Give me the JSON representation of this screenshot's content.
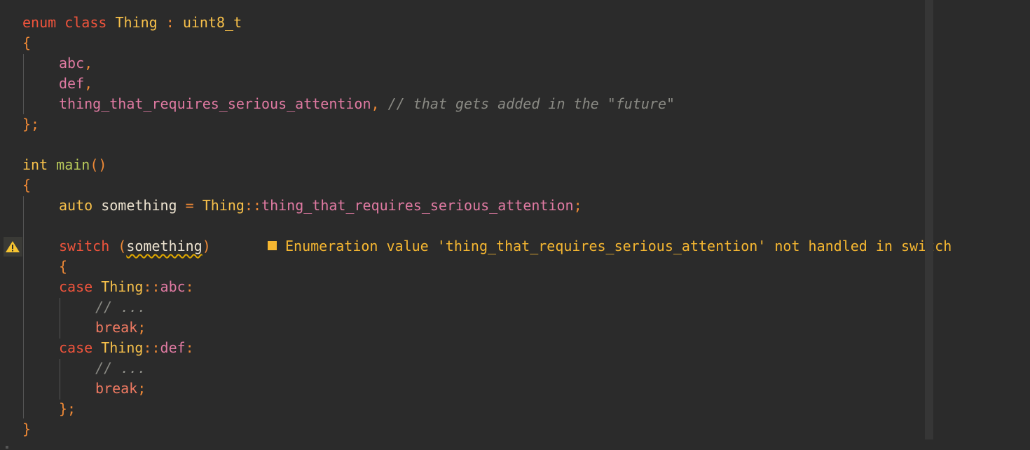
{
  "code": {
    "enum_kw": "enum",
    "class_kw": "class",
    "enum_name": "Thing",
    "colon": ":",
    "underlying_type": "uint8_t",
    "open_brace": "{",
    "close_brace": "}",
    "close_brace_semi": "};",
    "semicolon": ";",
    "comma": ",",
    "enumerators": [
      "abc",
      "def",
      "thing_that_requires_serious_attention"
    ],
    "enum_comment": "// that gets added in the \"future\"",
    "int_kw": "int",
    "main_name": "main",
    "main_parens": "()",
    "auto_kw": "auto",
    "var_name": "something",
    "assign_op": "=",
    "scope_op": "::",
    "switch_kw": "switch",
    "paren_open": "(",
    "paren_close": ")",
    "case_kw": "case",
    "case_colon": ":",
    "case_comment": "// ...",
    "break_kw": "break"
  },
  "diagnostic": {
    "message": "Enumeration value 'thing_that_requires_serious_attention' not handled in switch",
    "severity": "warning",
    "color": "#f6b731"
  },
  "colors": {
    "background": "#2b2b2b",
    "keyword": "#f0543c",
    "type": "#f7c04a",
    "function": "#b8c95a",
    "enumerator": "#e07aa2",
    "punctuation": "#f08a36",
    "comment": "#8a8a84"
  }
}
